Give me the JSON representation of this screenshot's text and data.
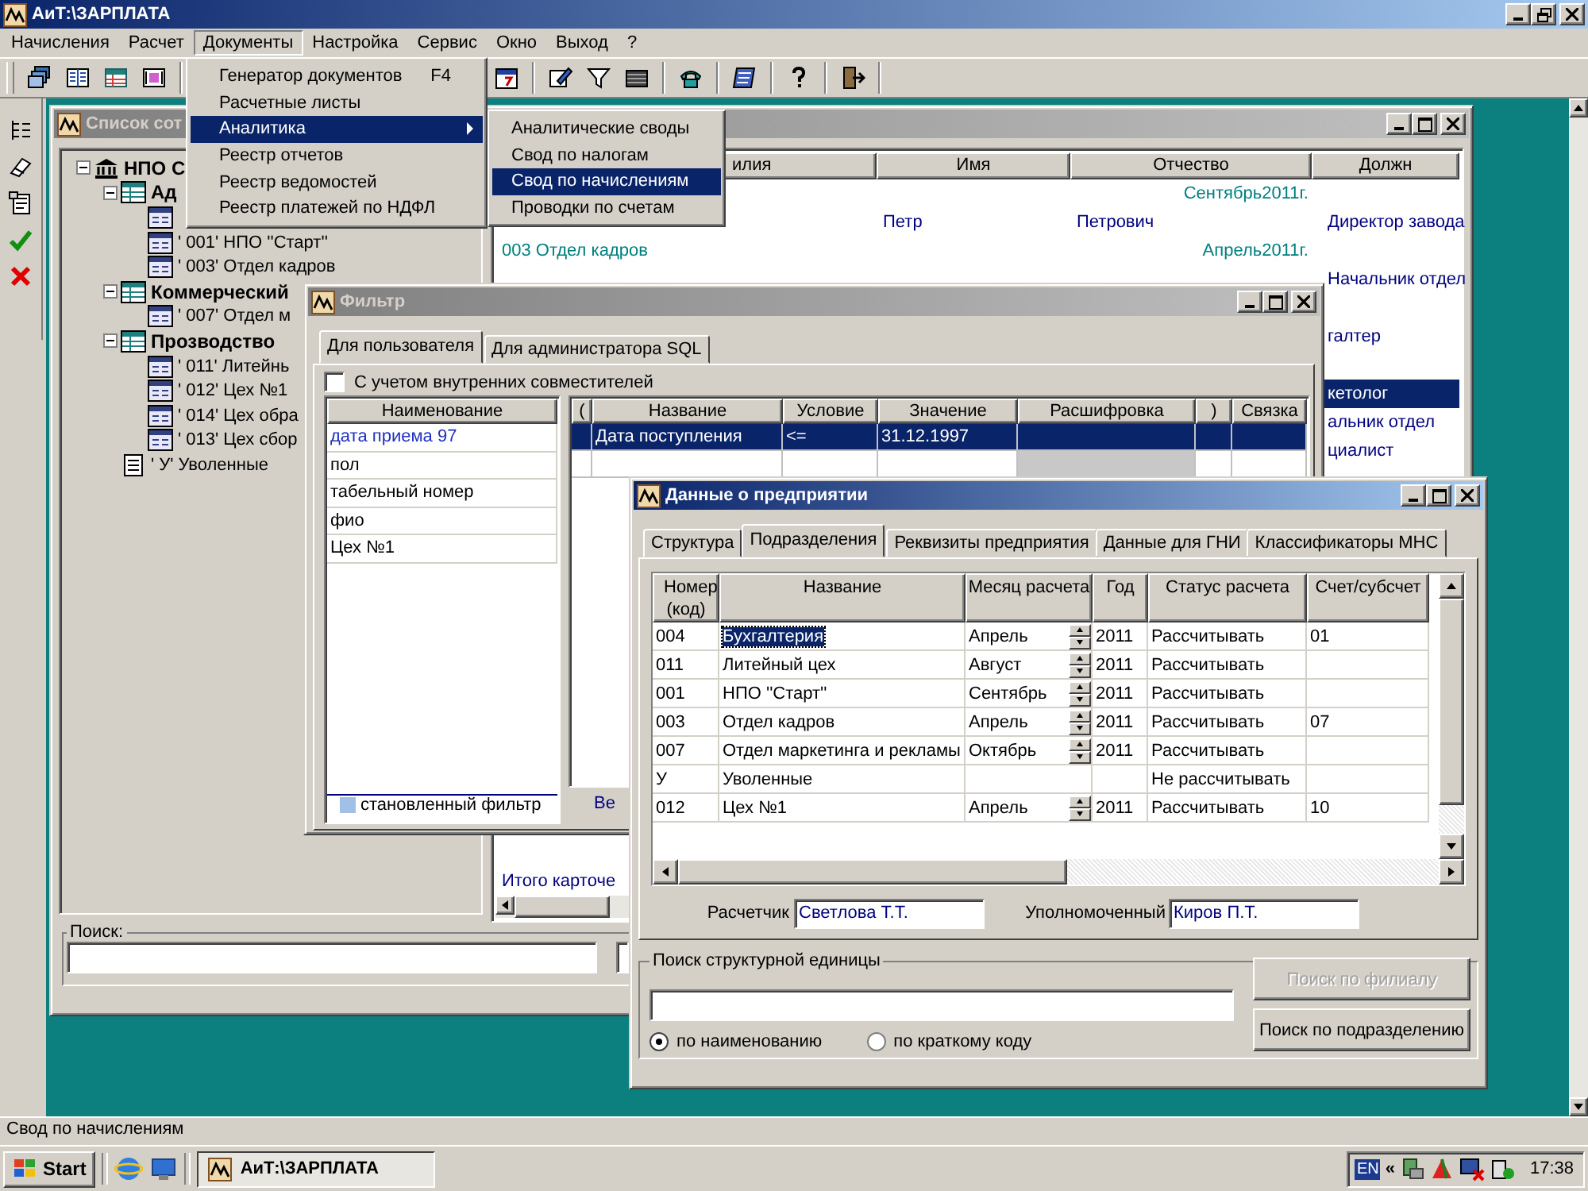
{
  "app": {
    "title": "АиТ:\\ЗАРПЛАТА"
  },
  "menu": [
    {
      "label": "Начисления",
      "selected": false
    },
    {
      "label": "Расчет",
      "selected": false
    },
    {
      "label": "Документы",
      "selected": true
    },
    {
      "label": "Настройка",
      "selected": false
    },
    {
      "label": "Сервис",
      "selected": false
    },
    {
      "label": "Окно",
      "selected": false
    },
    {
      "label": "Выход",
      "selected": false
    },
    {
      "label": "?",
      "selected": false
    }
  ],
  "documents_menu": [
    {
      "label": "Генератор документов",
      "shortcut": "F4",
      "submenu": false,
      "selected": false
    },
    {
      "label": "Расчетные листы",
      "submenu": false,
      "selected": false
    },
    {
      "label": "Аналитика",
      "submenu": true,
      "selected": true
    },
    {
      "label": "Реестр отчетов",
      "submenu": false,
      "selected": false
    },
    {
      "label": "Реестр ведомостей",
      "submenu": false,
      "selected": false
    },
    {
      "label": "Реестр платежей по НДФЛ",
      "submenu": false,
      "selected": false
    }
  ],
  "analytics_menu": [
    {
      "label": "Аналитические своды",
      "selected": false
    },
    {
      "label": "Свод по налогам",
      "selected": false
    },
    {
      "label": "Свод по начислениям",
      "selected": true
    },
    {
      "label": "Проводки по счетам",
      "selected": false
    }
  ],
  "employees_window": {
    "title": "Список сот",
    "active": false,
    "tree": [
      {
        "kind": "company",
        "label": "НПО С",
        "expanded": true,
        "children": [
          {
            "kind": "division",
            "label": "Ад",
            "expanded": true,
            "children": [
              {
                "kind": "unit"
              },
              {
                "kind": "unit",
                "label": "' 001' НПО ''Старт''"
              },
              {
                "kind": "unit",
                "label": "' 003' Отдел кадров"
              }
            ]
          },
          {
            "kind": "division",
            "label": "Коммерческий",
            "expanded": true,
            "children": [
              {
                "kind": "unit",
                "label": "' 007' Отдел м"
              }
            ]
          },
          {
            "kind": "division",
            "label": "Прозводство",
            "expanded": true,
            "children": [
              {
                "kind": "unit",
                "label": "' 011' Литейнь"
              },
              {
                "kind": "unit",
                "label": "' 012' Цех №1"
              },
              {
                "kind": "unit",
                "label": "' 014' Цех обра"
              },
              {
                "kind": "unit",
                "label": "' 013' Цех сбор"
              }
            ]
          },
          {
            "kind": "dismissed",
            "label": "' У' Уволенные"
          }
        ]
      }
    ],
    "columns": [
      "илия",
      "Имя",
      "Отчество",
      "Должн"
    ],
    "rows": [
      {
        "kind": "group",
        "period": "Сентябрь2011г."
      },
      {
        "kind": "record",
        "selected": false,
        "column_2": "Петр",
        "column_3": "Петрович",
        "column_4": "Директор завода"
      },
      {
        "kind": "group",
        "label": "003  Отдел кадров",
        "period": "Апрель2011г."
      },
      {
        "kind": "record",
        "selected": false,
        "column_4": "Начальник отдел"
      },
      {
        "kind": "record",
        "selected": false
      },
      {
        "kind": "record",
        "selected": false,
        "column_4": "галтер"
      },
      {
        "kind": "record",
        "selected": false
      },
      {
        "kind": "record",
        "selected": true,
        "column_4": "кетолог"
      },
      {
        "kind": "record",
        "selected": false,
        "column_4": "альник отдел"
      },
      {
        "kind": "record",
        "selected": false,
        "column_4": "циалист"
      }
    ],
    "total": "Итого карточе",
    "search_label": "Поиск:"
  },
  "filter_window": {
    "title": "Фильтр",
    "active": false,
    "tabs": [
      {
        "label": "Для пользователя",
        "selected": true
      },
      {
        "label": "Для администратора SQL",
        "selected": false
      }
    ],
    "part_timers": {
      "label": "С учетом внутренних совместителей",
      "checked": false
    },
    "fields_header": "Наименование",
    "fields": [
      {
        "label": "дата приема 97",
        "selected": true
      },
      {
        "label": "пол",
        "selected": false
      },
      {
        "label": "табельный номер",
        "selected": false
      },
      {
        "label": "фио",
        "selected": false
      },
      {
        "label": "Цех №1",
        "selected": false
      }
    ],
    "fields_footer": "становленный фильтр",
    "button_fragment": "Ве",
    "columns": [
      "(",
      "Название",
      "Условие",
      "Значение",
      "Расшифровка",
      ")",
      "Связка"
    ],
    "rows": [
      {
        "selected": true,
        "name": "Дата поступления",
        "condition": "<=",
        "value": "31.12.1997"
      },
      {
        "selected": false
      }
    ]
  },
  "data_window": {
    "title": "Данные о предприятии",
    "active": true,
    "tabs": [
      {
        "label": "Структура",
        "selected": false
      },
      {
        "label": "Подразделения",
        "selected": true
      },
      {
        "label": "Реквизиты предприятия",
        "selected": false
      },
      {
        "label": "Данные для ГНИ",
        "selected": false
      },
      {
        "label": "Классификаторы МНС",
        "selected": false
      }
    ],
    "columns": [
      "Номер (код)",
      "Название",
      "Месяц расчета",
      "Год",
      "Статус  расчета",
      "Счет/субсчет"
    ],
    "rows": [
      {
        "code": "004",
        "name": "Бухгалтерия",
        "name_selected": true,
        "month": "Апрель",
        "year": "2011",
        "status": "Рассчитывать",
        "account": "01"
      },
      {
        "code": "011",
        "name": "Литейный цех",
        "name_selected": false,
        "month": "Август",
        "year": "2011",
        "status": "Рассчитывать"
      },
      {
        "code": "001",
        "name": "НПО ''Старт''",
        "name_selected": false,
        "month": "Сентябрь",
        "year": "2011",
        "status": "Рассчитывать"
      },
      {
        "code": "003",
        "name": "Отдел кадров",
        "name_selected": false,
        "month": "Апрель",
        "year": "2011",
        "status": "Рассчитывать",
        "account": "07"
      },
      {
        "code": "007",
        "name": "Отдел маркетинга и рекламы",
        "name_selected": false,
        "month": "Октябрь",
        "year": "2011",
        "status": "Рассчитывать"
      },
      {
        "code": "У",
        "name": "Уволенные",
        "name_selected": false,
        "status": "Не рассчитывать"
      },
      {
        "code": "012",
        "name": "Цех №1",
        "name_selected": false,
        "month": "Апрель",
        "year": "2011",
        "status": "Рассчитывать",
        "account": "10"
      }
    ],
    "accountant": {
      "label": "Расчетчик",
      "value": "Светлова Т.Т."
    },
    "authorized": {
      "label": "Уполномоченный",
      "value": "Киров П.Т."
    },
    "search": {
      "title": "Поиск структурной единицы",
      "radios": [
        {
          "label": "по наименованию",
          "selected": true
        },
        {
          "label": "по краткому коду",
          "selected": false
        }
      ],
      "buttons": [
        {
          "label": "Поиск по филиалу",
          "disabled": true
        },
        {
          "label": "Поиск по подразделению",
          "disabled": false
        }
      ]
    }
  },
  "status_bar": "Свод по начислениям",
  "taskbar": {
    "start": "Start",
    "task": "АиТ:\\ЗАРПЛАТА",
    "language": "EN",
    "chevron": "«",
    "clock": "17:38"
  }
}
